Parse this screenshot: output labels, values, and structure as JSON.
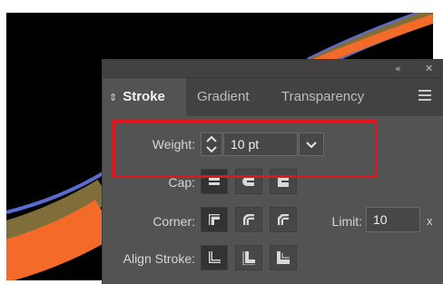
{
  "colors": {
    "art_background": "#000000",
    "stroke_orange": "#f36a29",
    "stroke_olive": "#7f6e3a",
    "stroke_blue": "#5a6cd2",
    "panel_bg": "#535353",
    "tabbar_bg": "#424242",
    "field_bg": "#474747",
    "highlight": "#e4141d"
  },
  "panel": {
    "header_icons": {
      "collapse": "«",
      "close": "✕"
    },
    "tabs": [
      {
        "label": "Stroke",
        "active": true,
        "arrows": "⇕"
      },
      {
        "label": "Gradient",
        "active": false
      },
      {
        "label": "Transparency",
        "active": false
      }
    ],
    "menu_icon": "panel-menu-icon"
  },
  "weight": {
    "label": "Weight:",
    "value": "10 pt",
    "icons": [
      "stepper-up-icon",
      "stepper-down-icon",
      "chevron-down-icon"
    ]
  },
  "cap": {
    "label": "Cap:",
    "options": [
      "butt-cap-icon",
      "round-cap-icon",
      "projecting-cap-icon"
    ],
    "selected": 0
  },
  "corner": {
    "label": "Corner:",
    "options": [
      "miter-join-icon",
      "round-join-icon",
      "bevel-join-icon"
    ],
    "selected": 0
  },
  "limit": {
    "label": "Limit:",
    "value": "10",
    "unit": "x"
  },
  "align_stroke": {
    "label": "Align Stroke:",
    "options": [
      "align-center-icon",
      "align-inside-icon",
      "align-outside-icon"
    ],
    "selected": 0
  }
}
